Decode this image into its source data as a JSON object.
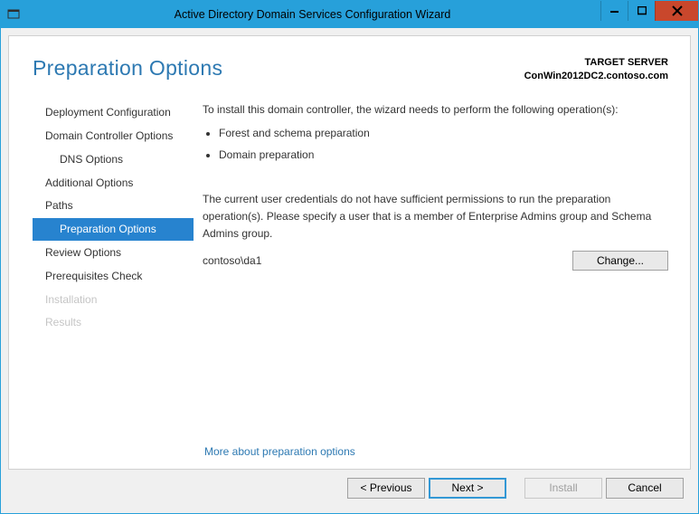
{
  "window": {
    "title": "Active Directory Domain Services Configuration Wizard"
  },
  "header": {
    "page_title": "Preparation Options",
    "target_label": "TARGET SERVER",
    "target_value": "ConWin2012DC2.contoso.com"
  },
  "sidebar": {
    "items": [
      {
        "label": "Deployment Configuration",
        "indent": 0,
        "selected": false,
        "disabled": false
      },
      {
        "label": "Domain Controller Options",
        "indent": 0,
        "selected": false,
        "disabled": false
      },
      {
        "label": "DNS Options",
        "indent": 1,
        "selected": false,
        "disabled": false
      },
      {
        "label": "Additional Options",
        "indent": 0,
        "selected": false,
        "disabled": false
      },
      {
        "label": "Paths",
        "indent": 0,
        "selected": false,
        "disabled": false
      },
      {
        "label": "Preparation Options",
        "indent": 1,
        "selected": true,
        "disabled": false
      },
      {
        "label": "Review Options",
        "indent": 0,
        "selected": false,
        "disabled": false
      },
      {
        "label": "Prerequisites Check",
        "indent": 0,
        "selected": false,
        "disabled": false
      },
      {
        "label": "Installation",
        "indent": 0,
        "selected": false,
        "disabled": true
      },
      {
        "label": "Results",
        "indent": 0,
        "selected": false,
        "disabled": true
      }
    ]
  },
  "main": {
    "intro_line": "To install this domain controller, the wizard needs to perform the following operation(s):",
    "bullets": [
      "Forest and schema preparation",
      "Domain preparation"
    ],
    "warning_text": "The current user credentials do not have sufficient permissions to run the preparation operation(s). Please specify a user that is a member of Enterprise Admins group and Schema Admins group.",
    "credentials_value": "contoso\\da1",
    "change_button_label": "Change...",
    "more_link": "More about preparation options"
  },
  "footer": {
    "previous": "< Previous",
    "next": "Next >",
    "install": "Install",
    "cancel": "Cancel"
  }
}
